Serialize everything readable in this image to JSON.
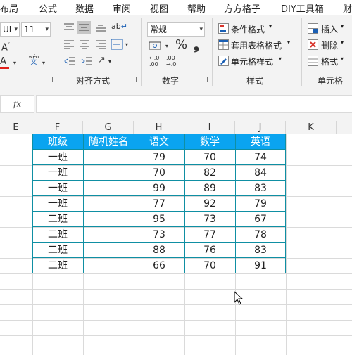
{
  "ribbon_tabs": [
    "布局",
    "公式",
    "数据",
    "审阅",
    "视图",
    "帮助",
    "方方格子",
    "DIY工具箱",
    "财"
  ],
  "font": {
    "name_partial": "UI",
    "size": "11",
    "decrease_font": "A",
    "red_a": "A",
    "wen_top": "wén",
    "wen_bottom": "文"
  },
  "alignment": {
    "label": "对齐方式",
    "wrap_glyph": "ab"
  },
  "number": {
    "label": "数字",
    "format_value": "常规",
    "percent": "%",
    "comma": "❟",
    "inc_decimal": ".00",
    "dec_decimal": ".0"
  },
  "styles": {
    "label": "样式",
    "conditional_format": "条件格式",
    "table_format": "套用表格格式",
    "cell_styles": "单元格样式"
  },
  "cells": {
    "label": "单元格",
    "insert": "插入",
    "delete": "删除",
    "format": "格式"
  },
  "formula_bar": {
    "fx": "fx",
    "value": ""
  },
  "columns": [
    "E",
    "F",
    "G",
    "H",
    "I",
    "J",
    "K"
  ],
  "table": {
    "headers": [
      "班级",
      "随机姓名",
      "语文",
      "数学",
      "英语"
    ],
    "rows": [
      [
        "一班",
        "",
        "79",
        "70",
        "74"
      ],
      [
        "一班",
        "",
        "70",
        "82",
        "84"
      ],
      [
        "一班",
        "",
        "99",
        "89",
        "83"
      ],
      [
        "一班",
        "",
        "77",
        "92",
        "79"
      ],
      [
        "二班",
        "",
        "95",
        "73",
        "67"
      ],
      [
        "二班",
        "",
        "73",
        "77",
        "78"
      ],
      [
        "二班",
        "",
        "88",
        "76",
        "83"
      ],
      [
        "二班",
        "",
        "66",
        "70",
        "91"
      ]
    ]
  },
  "colors": {
    "header_fill": "#0aa4f0",
    "table_border": "#0f8fa3",
    "font_color_red": "#e0201b"
  }
}
